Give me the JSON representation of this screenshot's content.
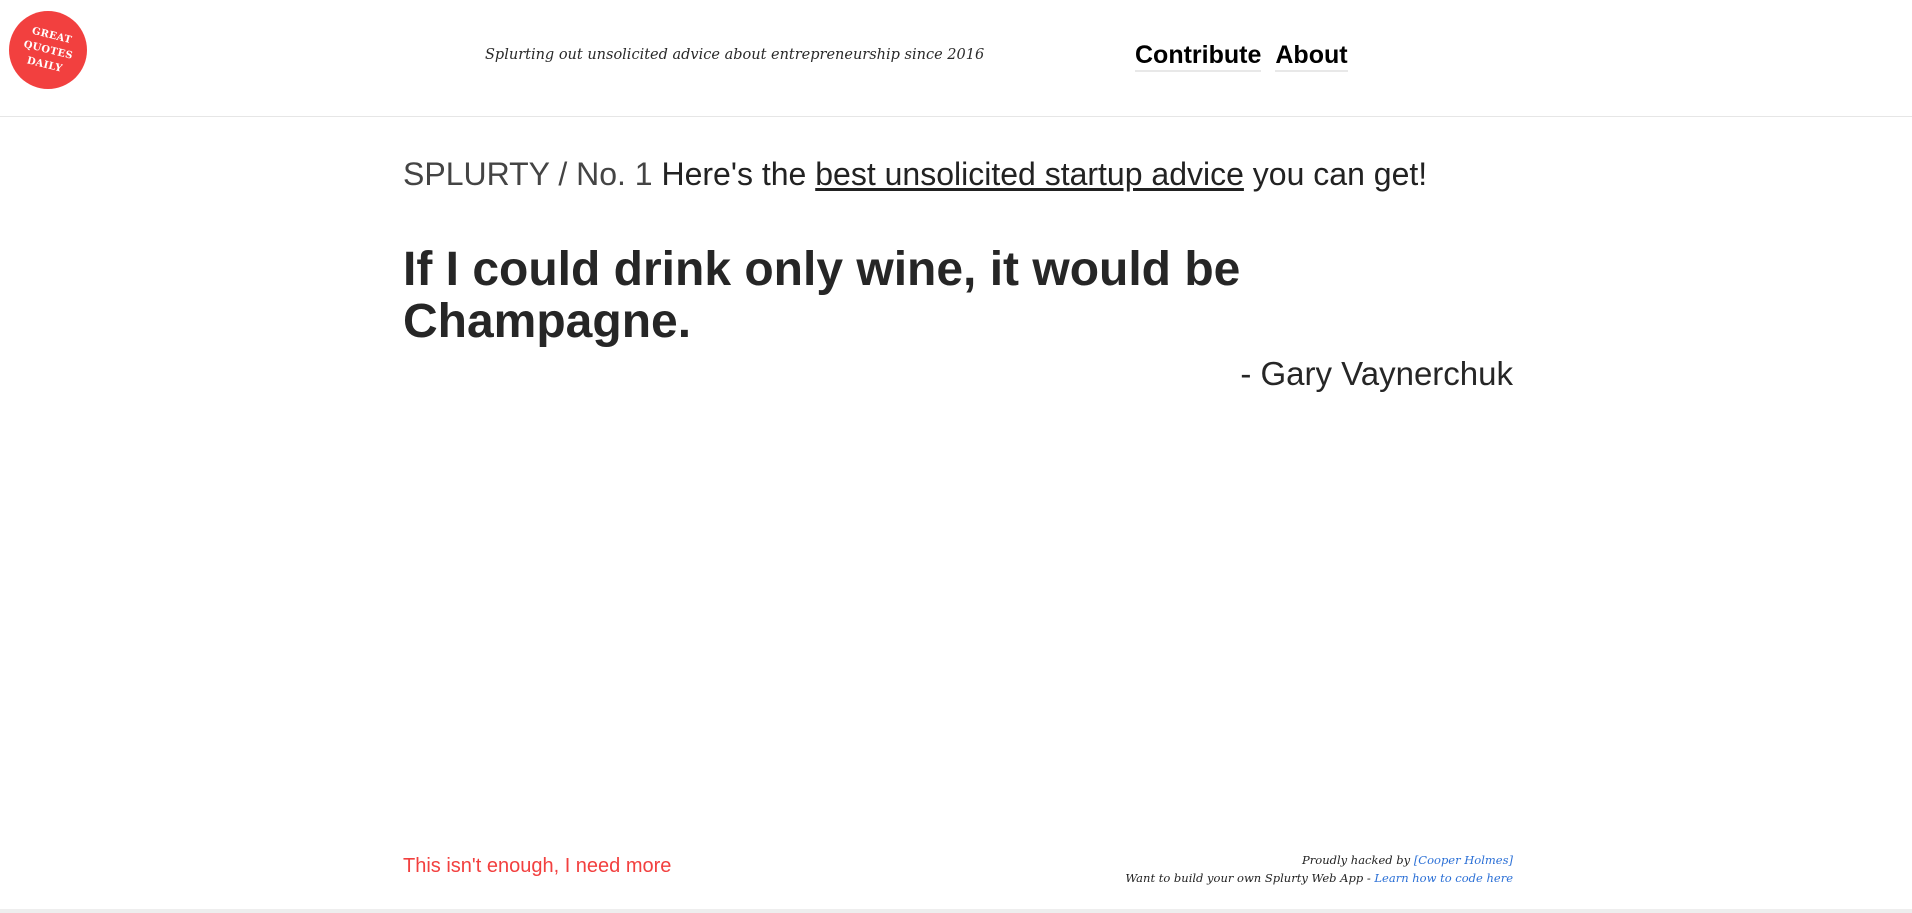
{
  "header": {
    "logo_lines": [
      "GREAT",
      "QUOTES",
      "DAILY"
    ],
    "tagline": "Splurting out unsolicited advice about entrepreneurship since 2016",
    "nav": [
      {
        "label": "Contribute"
      },
      {
        "label": "About"
      }
    ]
  },
  "main": {
    "breadcrumb_brand": "SPLURTY / No. 1",
    "intro_prefix": "Here's the",
    "intro_link": "best unsolicited startup advice",
    "intro_suffix": "you can get!",
    "quote": "If I could drink only wine, it would be Champagne.",
    "author": "- Gary Vaynerchuk"
  },
  "footer": {
    "more_link": "This isn't enough, I need more",
    "credit_prefix": "Proudly hacked by",
    "credit_link": "[Cooper Holmes]",
    "build_prefix": "Want to build your own Splurty Web App -",
    "build_link": "Learn how to code here"
  },
  "colors": {
    "brand_red": "#f2403f",
    "link_blue": "#2a6fd6",
    "text_dark": "#262626"
  }
}
